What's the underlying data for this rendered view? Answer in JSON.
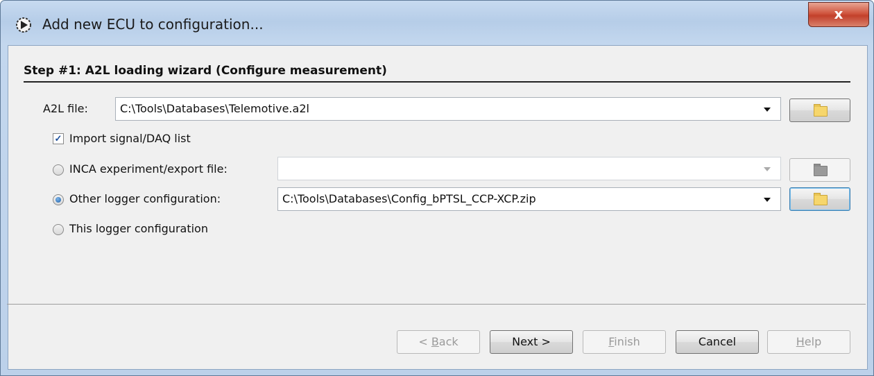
{
  "window": {
    "title": "Add new ECU to configuration...",
    "close_label": "x"
  },
  "step": {
    "title": "Step #1: A2L loading wizard (Configure measurement)"
  },
  "a2l": {
    "label": "A2L file:",
    "value": "C:\\Tools\\Databases\\Telemotive.a2l"
  },
  "import": {
    "label": "Import signal/DAQ list",
    "checked": true
  },
  "options": {
    "inca": {
      "label": "INCA experiment/export file:",
      "value": "",
      "selected": false,
      "enabled": false
    },
    "other": {
      "label": "Other logger configuration:",
      "value": "C:\\Tools\\Databases\\Config_bPTSL_CCP-XCP.zip",
      "selected": true
    },
    "this": {
      "label": "This logger configuration",
      "selected": false
    }
  },
  "buttons": {
    "back": {
      "pre": "< ",
      "mnemonic": "B",
      "rest": "ack",
      "enabled": false
    },
    "next": {
      "label": "Next >",
      "enabled": true
    },
    "finish": {
      "mnemonic": "F",
      "rest": "inish",
      "enabled": false
    },
    "cancel": {
      "label": "Cancel",
      "enabled": true
    },
    "help": {
      "mnemonic": "H",
      "rest": "elp",
      "enabled": false
    }
  },
  "icons": {
    "app": "gear-wizard-icon",
    "browse": "folder-icon",
    "dropdown": "chevron-down-icon"
  },
  "colors": {
    "title_bar": "#c3d7ee",
    "close_button": "#c2402b",
    "client_bg": "#f0f0f0",
    "radio_selected": "#1d5fa8"
  }
}
